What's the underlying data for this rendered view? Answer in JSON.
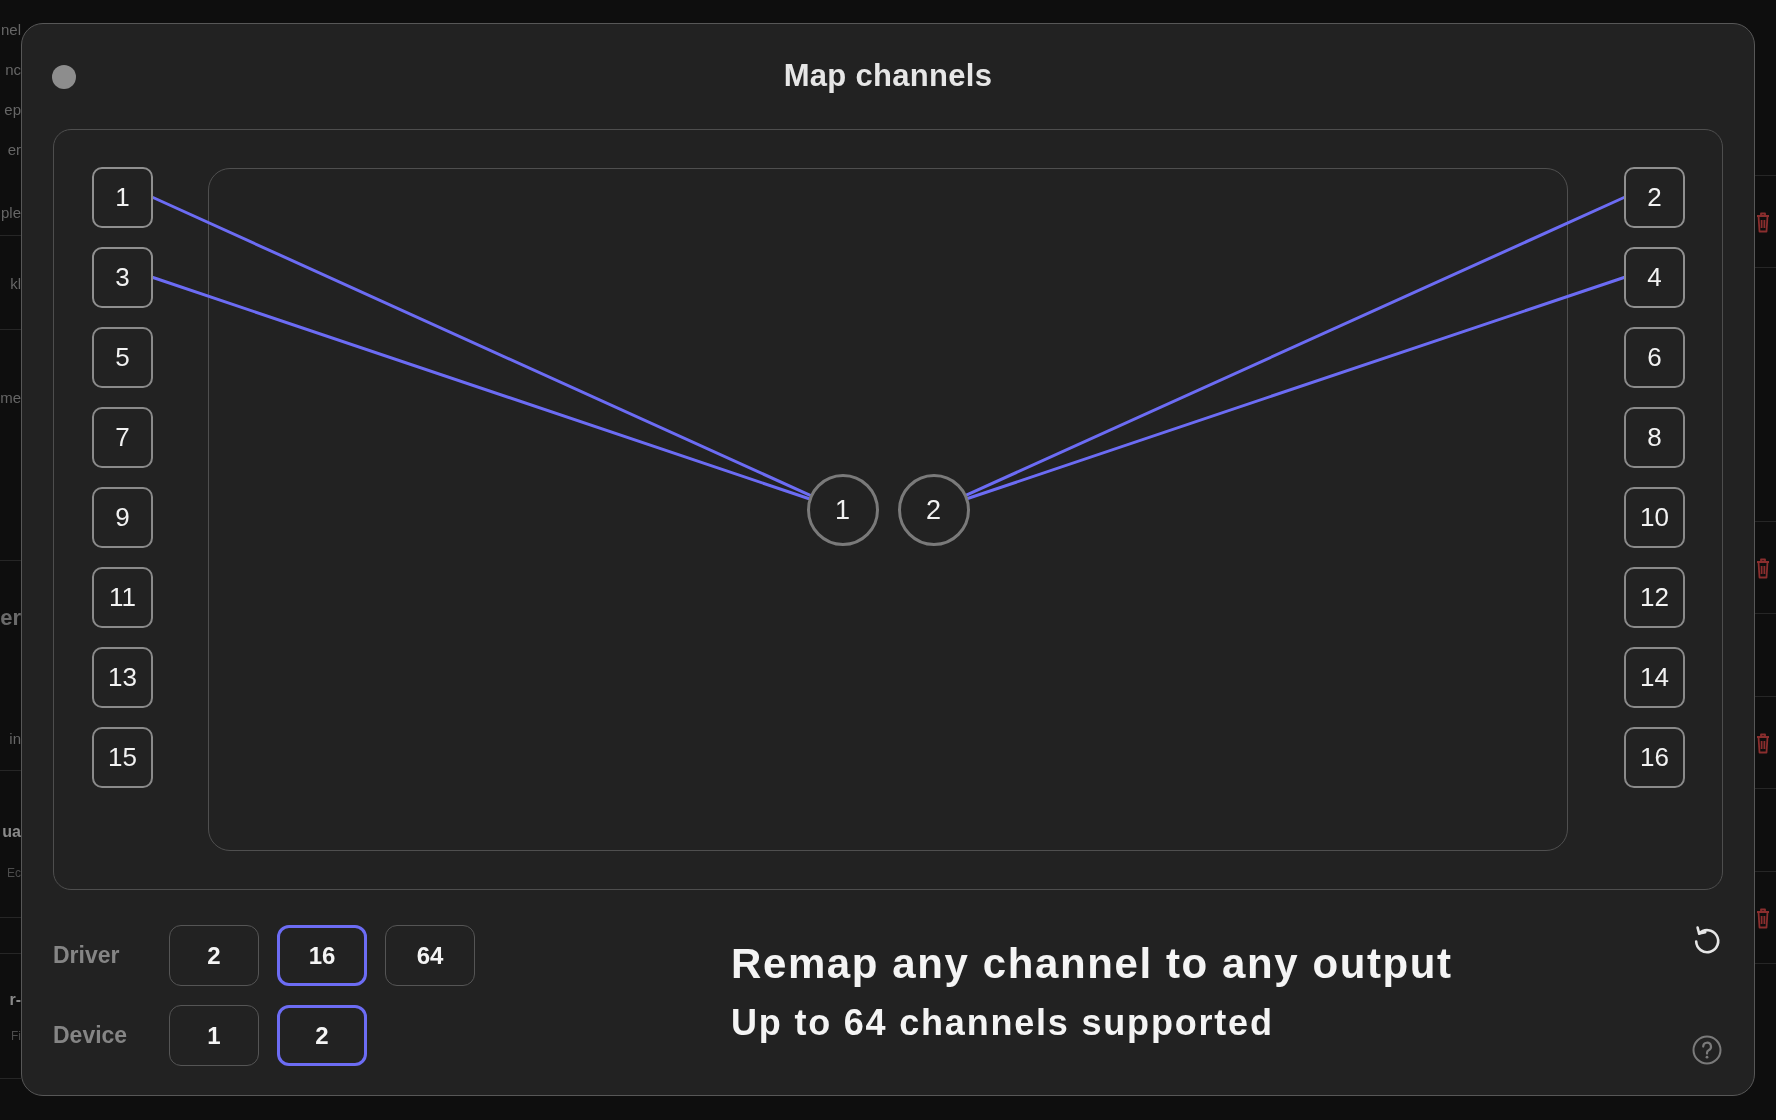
{
  "background": {
    "groups": [
      {
        "lines": [
          {
            "text": "nel",
            "kind": "body"
          },
          {
            "text": "nc",
            "kind": "body"
          },
          {
            "text": "ep",
            "kind": "body"
          },
          {
            "text": "er",
            "kind": "body"
          },
          {
            "text": "ple",
            "kind": "body"
          }
        ]
      },
      {
        "lines": [
          {
            "text": "kl",
            "kind": "body"
          }
        ]
      },
      {
        "lines": [
          {
            "text": "me",
            "kind": "body"
          }
        ]
      },
      {
        "lines": [
          {
            "text": "er",
            "kind": "heading"
          },
          {
            "text": "in",
            "kind": "body"
          }
        ]
      },
      {
        "lines": [
          {
            "text": "ua",
            "kind": "strong"
          },
          {
            "text": "Ec",
            "kind": "caption"
          }
        ]
      },
      {
        "lines": [
          {
            "text": "r-",
            "kind": "strong"
          },
          {
            "text": "Fi",
            "kind": "caption"
          }
        ]
      }
    ]
  },
  "dialog": {
    "title": "Map channels",
    "left_channels": [
      {
        "label": "1",
        "linked": true
      },
      {
        "label": "3",
        "linked": true
      },
      {
        "label": "5",
        "linked": false
      },
      {
        "label": "7",
        "linked": false
      },
      {
        "label": "9",
        "linked": false
      },
      {
        "label": "11",
        "linked": false
      },
      {
        "label": "13",
        "linked": false
      },
      {
        "label": "15",
        "linked": false
      }
    ],
    "right_channels": [
      {
        "label": "2",
        "linked": true
      },
      {
        "label": "4",
        "linked": true
      },
      {
        "label": "6",
        "linked": false
      },
      {
        "label": "8",
        "linked": false
      },
      {
        "label": "10",
        "linked": false
      },
      {
        "label": "12",
        "linked": false
      },
      {
        "label": "14",
        "linked": false
      },
      {
        "label": "16",
        "linked": false
      }
    ],
    "device_channels": [
      {
        "label": "1"
      },
      {
        "label": "2"
      }
    ],
    "driver": {
      "label": "Driver",
      "options": [
        {
          "label": "2",
          "selected": false
        },
        {
          "label": "16",
          "selected": true
        },
        {
          "label": "64",
          "selected": false
        }
      ]
    },
    "device": {
      "label": "Device",
      "options": [
        {
          "label": "1",
          "selected": false
        },
        {
          "label": "2",
          "selected": true
        }
      ]
    },
    "headline": "Remap any channel to any output",
    "subline": "Up to 64 channels supported"
  }
}
